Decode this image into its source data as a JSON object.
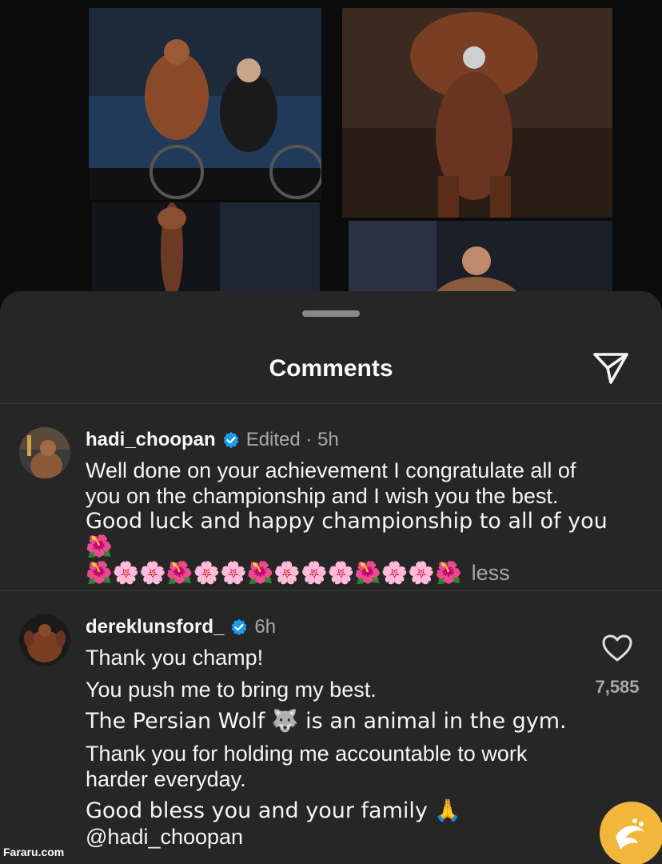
{
  "sheet": {
    "title": "Comments"
  },
  "icons": {
    "share": "paper-plane-icon",
    "verified": "verified-badge-icon",
    "like": "heart-outline-icon"
  },
  "colors": {
    "verified": "#1d9bf0",
    "sheet_bg": "#262626",
    "muted_text": "#a8a8a8",
    "watermark_logo": "#f2b63a"
  },
  "comments": [
    {
      "username": "hadi_choopan",
      "verified": true,
      "meta": "Edited · 5h",
      "text_line1": "Well done on your achievement  I congratulate all of",
      "text_line2": "you on the championship and I wish you the best.",
      "text_line3": "Good luck and happy championship to all of you🌺",
      "text_line4": "🌺🌸🌸🌺🌸🌸🌺🌸🌸🌸🌺🌸🌸🌺",
      "toggle_label": "less"
    },
    {
      "username": "dereklunsford_",
      "verified": true,
      "meta": "6h",
      "lines": [
        "Thank you champ!",
        "You push me to bring my best.",
        "The Persian Wolf 🐺 is an animal in the gym.",
        "Thank you for holding me accountable to work",
        "harder everyday.",
        "Good bless you and your family 🙏",
        "@hadi_choopan"
      ],
      "like_count": "7,585"
    }
  ],
  "watermark": {
    "text": "Fararu.com"
  }
}
